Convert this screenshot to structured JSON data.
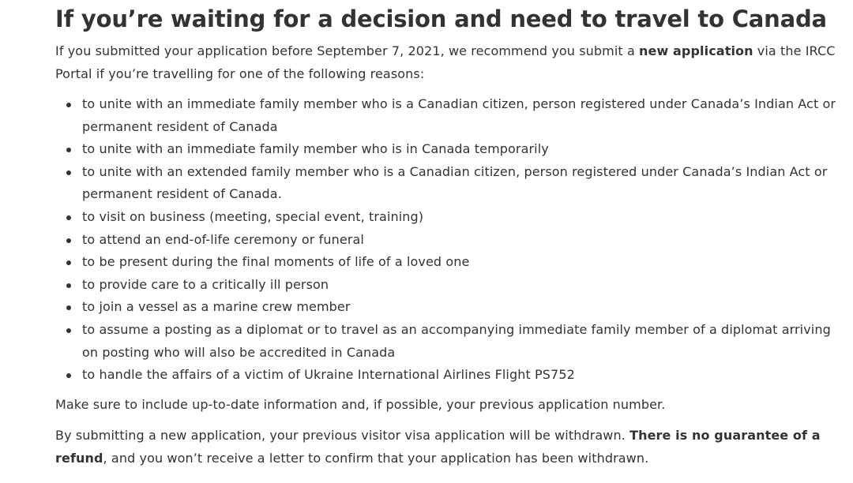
{
  "heading": "If you’re waiting for a decision and need to travel to Canada",
  "intro": {
    "before": "If you submitted your application before September 7, 2021, we recommend you submit a ",
    "bold": "new application",
    "after": " via the IRCC Portal if you’re travelling for one of the following reasons:"
  },
  "reasons": [
    "to unite with an immediate family member who is a Canadian citizen, person registered under Canada’s Indian Act or permanent resident of Canada",
    "to unite with an immediate family member who is in Canada temporarily",
    "to unite with an extended family member who is a Canadian citizen, person registered under Canada’s Indian Act or permanent resident of Canada.",
    "to visit on business (meeting, special event, training)",
    "to attend an end-of-life ceremony or funeral",
    "to be present during the final moments of life of a loved one",
    "to provide care to a critically ill person",
    "to join a vessel as a marine crew member",
    "to assume a posting as a diplomat or to travel as an accompanying immediate family member of a diplomat arriving on posting who will also be accredited in Canada",
    "to handle the affairs of a victim of Ukraine International Airlines Flight PS752"
  ],
  "note": "Make sure to include up-to-date information and, if possible, your previous application number.",
  "warning": {
    "before": "By submitting a new application, your previous visitor visa application will be withdrawn. ",
    "bold": "There is no guarantee of a refund",
    "after": ", and you won’t receive a letter to confirm that your application has been withdrawn."
  }
}
